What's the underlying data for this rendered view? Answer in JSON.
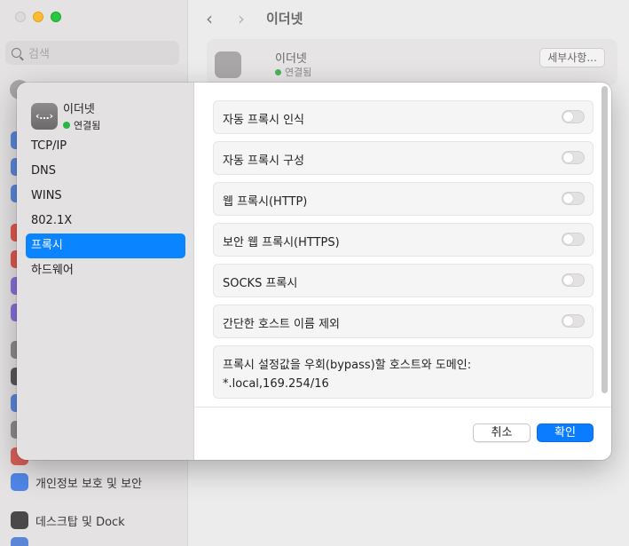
{
  "background": {
    "search_placeholder": "검색",
    "page_title": "이더넷",
    "card": {
      "name": "이더넷",
      "status": "연결됨",
      "details_button": "세부사항..."
    },
    "sidebar_items": [
      {
        "label": "개인정보 보호 및 보안"
      },
      {
        "label": "데스크탑 및 Dock"
      }
    ]
  },
  "sheet": {
    "header": {
      "name": "이더넷",
      "status": "연결됨"
    },
    "nav": [
      {
        "label": "TCP/IP"
      },
      {
        "label": "DNS"
      },
      {
        "label": "WINS"
      },
      {
        "label": "802.1X"
      },
      {
        "label": "프록시"
      },
      {
        "label": "하드웨어"
      }
    ],
    "active_nav": "프록시",
    "proxy_options": [
      {
        "label": "자동 프록시 인식",
        "enabled": false
      },
      {
        "label": "자동 프록시 구성",
        "enabled": false
      },
      {
        "label": "웹 프록시(HTTP)",
        "enabled": false
      },
      {
        "label": "보안 웹 프록시(HTTPS)",
        "enabled": false
      },
      {
        "label": "SOCKS 프록시",
        "enabled": false
      },
      {
        "label": "간단한 호스트 이름 제외",
        "enabled": false
      }
    ],
    "bypass": {
      "label": "프록시 설정값을 우회(bypass)할 호스트와 도메인:",
      "value": "*.local,169.254/16"
    },
    "buttons": {
      "cancel": "취소",
      "ok": "확인"
    }
  },
  "colors": {
    "accent": "#0a84ff",
    "connected": "#2bb543"
  }
}
